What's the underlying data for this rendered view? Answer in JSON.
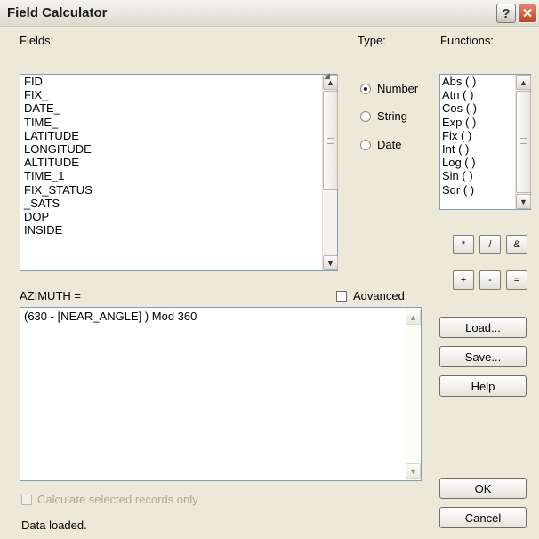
{
  "window": {
    "title": "Field Calculator"
  },
  "fields": {
    "label": "Fields:",
    "items": [
      "FID",
      "FIX_",
      "DATE_",
      "TIME_",
      "LATITUDE",
      "LONGITUDE",
      "ALTITUDE",
      "TIME_1",
      "FIX_STATUS",
      "_SATS",
      "DOP",
      "INSIDE"
    ]
  },
  "type": {
    "label": "Type:",
    "options": [
      "Number",
      "String",
      "Date"
    ],
    "selected": "Number"
  },
  "functions": {
    "label": "Functions:",
    "items": [
      "Abs ( )",
      "Atn ( )",
      "Cos ( )",
      "Exp ( )",
      "Fix ( )",
      "Int ( )",
      "Log ( )",
      "Sin ( )",
      "Sqr ( )"
    ]
  },
  "operators": [
    "*",
    "/",
    "&",
    "+",
    "-",
    "="
  ],
  "expression": {
    "label": "AZIMUTH =",
    "value": "(630 - [NEAR_ANGLE] ) Mod 360",
    "advanced_label": "Advanced",
    "advanced_checked": false
  },
  "buttons": {
    "load": "Load...",
    "save": "Save...",
    "help": "Help",
    "ok": "OK",
    "cancel": "Cancel"
  },
  "calc_selected": {
    "label": "Calculate selected records only",
    "enabled": false
  },
  "status": "Data loaded."
}
